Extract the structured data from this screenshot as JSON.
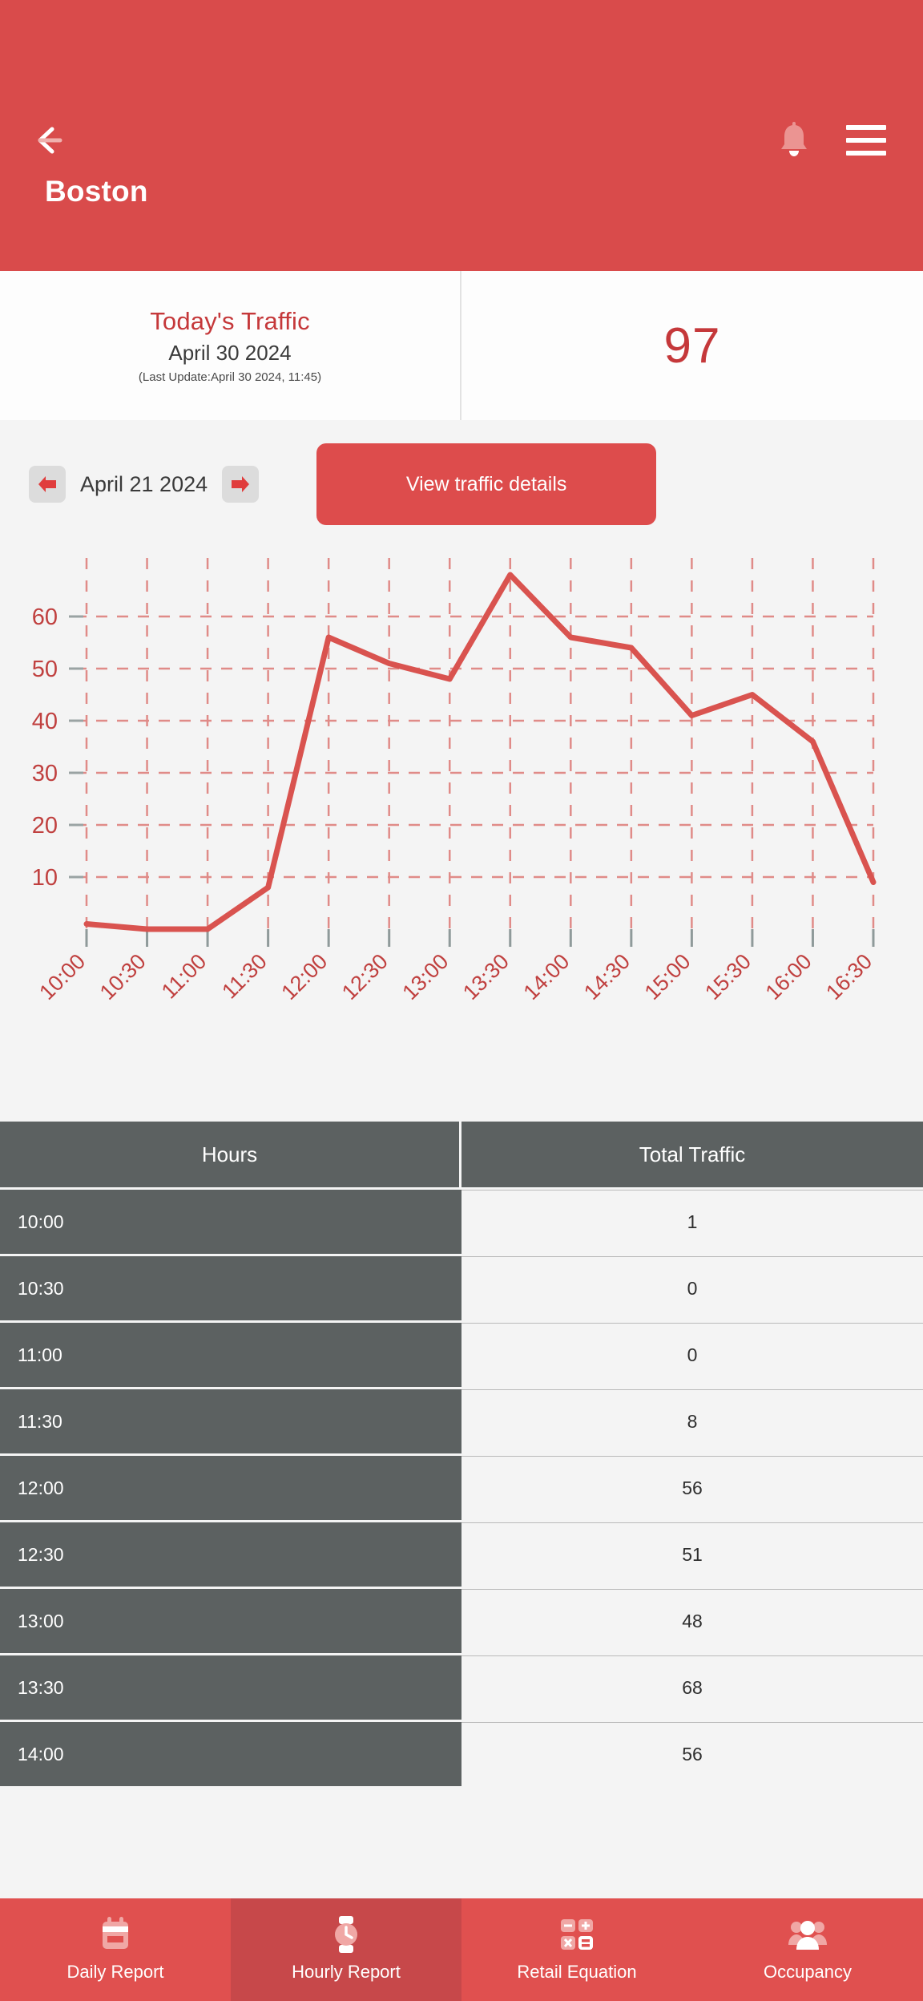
{
  "header": {
    "title": "Boston",
    "back_icon": "arrow-left-icon",
    "bell_icon": "bell-icon",
    "menu_icon": "hamburger-menu-icon",
    "background_color": "#d94b4b"
  },
  "summary": {
    "title": "Today's Traffic",
    "date": "April 30 2024",
    "last_update": "(Last Update:April 30 2024, 11:45)",
    "value": "97",
    "accent_color": "#c5383a"
  },
  "controls": {
    "prev_icon": "arrow-left-icon",
    "next_icon": "arrow-right-icon",
    "selected_date": "April 21 2024",
    "details_button": "View traffic details",
    "button_color": "#dd4c4c"
  },
  "chart_data": {
    "type": "line",
    "title": "",
    "xlabel": "",
    "ylabel": "",
    "x": [
      "10:00",
      "10:30",
      "11:00",
      "11:30",
      "12:00",
      "12:30",
      "13:00",
      "13:30",
      "14:00",
      "14:30",
      "15:00",
      "15:30",
      "16:00",
      "16:30"
    ],
    "values": [
      1,
      0,
      0,
      8,
      56,
      51,
      48,
      68,
      56,
      54,
      41,
      45,
      36,
      9
    ],
    "series": [
      {
        "name": "Total Traffic",
        "values": [
          1,
          0,
          0,
          8,
          56,
          51,
          48,
          68,
          56,
          54,
          41,
          45,
          36,
          9
        ]
      }
    ],
    "yticks": [
      10,
      20,
      30,
      40,
      50,
      60
    ],
    "ylim": [
      0,
      70
    ],
    "grid": true,
    "legend": "none",
    "line_color": "#d9534f",
    "grid_color": "#e08b88",
    "tick_label_color": "#c0403f",
    "xtick_rotation": -45
  },
  "table": {
    "columns": [
      "Hours",
      "Total Traffic"
    ],
    "rows": [
      {
        "hours": "10:00",
        "traffic": "1"
      },
      {
        "hours": "10:30",
        "traffic": "0"
      },
      {
        "hours": "11:00",
        "traffic": "0"
      },
      {
        "hours": "11:30",
        "traffic": "8"
      },
      {
        "hours": "12:00",
        "traffic": "56"
      },
      {
        "hours": "12:30",
        "traffic": "51"
      },
      {
        "hours": "13:00",
        "traffic": "48"
      },
      {
        "hours": "13:30",
        "traffic": "68"
      },
      {
        "hours": "14:00",
        "traffic": "56"
      }
    ]
  },
  "bottom_nav": {
    "active_index": 1,
    "items": [
      {
        "label": "Daily Report",
        "icon": "calendar-icon"
      },
      {
        "label": "Hourly Report",
        "icon": "watch-clock-icon"
      },
      {
        "label": "Retail Equation",
        "icon": "calculator-icon"
      },
      {
        "label": "Occupancy",
        "icon": "people-group-icon"
      }
    ]
  }
}
